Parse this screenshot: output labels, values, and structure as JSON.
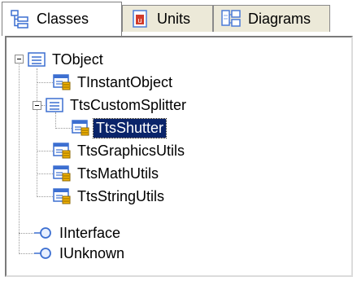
{
  "tabs": [
    {
      "label": "Classes",
      "icon": "class-tree-icon",
      "active": true
    },
    {
      "label": "Units",
      "icon": "unit-icon",
      "active": false
    },
    {
      "label": "Diagrams",
      "icon": "diagram-icon",
      "active": false
    }
  ],
  "tree": {
    "items": [
      {
        "label": "TObject",
        "icon": "class-list-icon",
        "expanded": true
      },
      {
        "label": "TInstantObject",
        "icon": "class-unit-icon"
      },
      {
        "label": "TtsCustomSplitter",
        "icon": "class-list-icon",
        "expanded": true
      },
      {
        "label": "TtsShutter",
        "icon": "class-unit-icon",
        "selected": true
      },
      {
        "label": "TtsGraphicsUtils",
        "icon": "class-unit-icon"
      },
      {
        "label": "TtsMathUtils",
        "icon": "class-unit-icon"
      },
      {
        "label": "TtsStringUtils",
        "icon": "class-unit-icon"
      },
      {
        "label": "IInterface",
        "icon": "interface-icon"
      },
      {
        "label": "IUnknown",
        "icon": "interface-icon"
      }
    ]
  },
  "colors": {
    "selection": "#0a246a",
    "tab_bg": "#ece9d8",
    "icon_blue": "#3c6fd1",
    "icon_gold": "#f4b400",
    "icon_red": "#c0392b"
  }
}
